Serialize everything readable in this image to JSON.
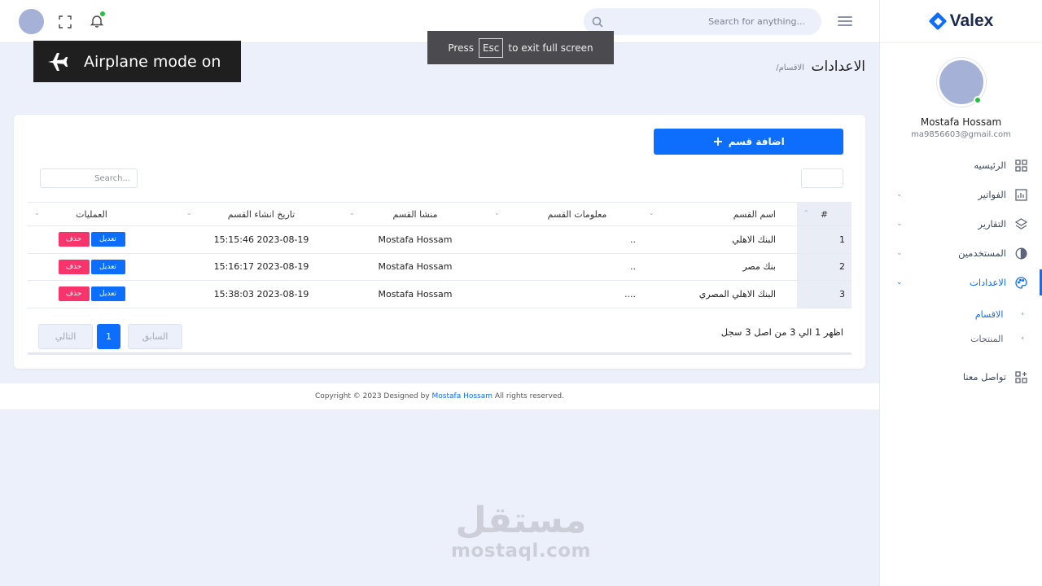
{
  "brand": {
    "name": "Valex",
    "accent": "#0d6efd"
  },
  "header": {
    "search_placeholder": "Search for anything...",
    "icons": [
      "menu-icon",
      "search-icon",
      "fullscreen-icon",
      "bell-icon"
    ]
  },
  "overlays": {
    "airplane_text": "Airplane mode on",
    "esc_press": "Press",
    "esc_key": "Esc",
    "esc_suffix": "to exit full screen"
  },
  "sidebar": {
    "user_name": "Mostafa Hossam",
    "user_email": "ma9856603@gmail.com",
    "items": [
      {
        "label": "الرئيسيه",
        "icon": "dashboard-icon"
      },
      {
        "label": "الفواتير",
        "icon": "invoice-chart-icon"
      },
      {
        "label": "التقارير",
        "icon": "layers-icon"
      },
      {
        "label": "المستخدمين",
        "icon": "users-circle-icon"
      },
      {
        "label": "الاعدادات",
        "icon": "palette-icon"
      }
    ],
    "sub_items": [
      {
        "label": "الاقسام"
      },
      {
        "label": "المنتجات"
      }
    ],
    "contact": {
      "label": "تواصل معنا",
      "icon": "apps-add-icon"
    }
  },
  "page": {
    "title": "الاعدادات",
    "breadcrumb": "/الاقسام"
  },
  "card": {
    "add_button": "اضافة قسم",
    "table_search_placeholder": "Search...",
    "columns": [
      "#",
      "اسم القسم",
      "معلومات القسم",
      "منشا القسم",
      "تاريخ انشاء القسم",
      "العمليات"
    ],
    "rows": [
      {
        "num": "1",
        "name": "البنك الاهلي",
        "info": "..",
        "creator": "Mostafa Hossam",
        "date": "2023-08-19 15:15:46",
        "edit": "تعديل",
        "delete": "حذف"
      },
      {
        "num": "2",
        "name": "بنك مصر",
        "info": "..",
        "creator": "Mostafa Hossam",
        "date": "2023-08-19 15:16:17",
        "edit": "تعديل",
        "delete": "حذف"
      },
      {
        "num": "3",
        "name": "البنك الاهلي المصري",
        "info": "....",
        "creator": "Mostafa Hossam",
        "date": "2023-08-19 15:38:03",
        "edit": "تعديل",
        "delete": "حذف"
      }
    ],
    "info_text": "اظهر 1 الي 3 من اصل 3 سجل",
    "pagination": {
      "next": "التالي",
      "current": "1",
      "prev": "السابق"
    }
  },
  "footer": {
    "prefix": "Copyright © 2023 Designed by",
    "author": "Mostafa Hossam",
    "suffix": "All rights reserved."
  },
  "watermark": {
    "arabic": "مستقل",
    "latin": "mostaql.com"
  }
}
